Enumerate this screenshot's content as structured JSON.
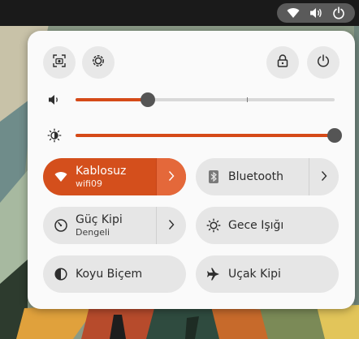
{
  "topbar": {
    "indicators": [
      {
        "icon": "wifi-icon"
      },
      {
        "icon": "volume-icon"
      },
      {
        "icon": "power-icon"
      }
    ]
  },
  "quick_settings": {
    "header_buttons": [
      {
        "icon": "screenshot-icon",
        "label": "Screenshot"
      },
      {
        "icon": "settings-icon",
        "label": "Settings"
      },
      {
        "icon": "lock-icon",
        "label": "Lock"
      },
      {
        "icon": "power-off-icon",
        "label": "Power Off"
      }
    ],
    "sliders": {
      "volume": {
        "icon": "speaker-icon",
        "value": 0.28,
        "marker": 0.66
      },
      "brightness": {
        "icon": "brightness-icon",
        "value": 1.0
      }
    },
    "tiles": {
      "wifi": {
        "title": "Kablosuz",
        "subtitle": "wifi09",
        "active": true,
        "icon": "wifi-icon"
      },
      "bluetooth": {
        "title": "Bluetooth",
        "subtitle": "",
        "active": false,
        "icon": "bluetooth-icon"
      },
      "power_mode": {
        "title": "Güç Kipi",
        "subtitle": "Dengeli",
        "active": false,
        "icon": "power-mode-icon"
      },
      "night_light": {
        "title": "Gece Işığı",
        "subtitle": "",
        "active": false,
        "icon": "night-light-icon"
      },
      "dark_style": {
        "title": "Koyu Biçem",
        "subtitle": "",
        "active": false,
        "icon": "dark-style-icon"
      },
      "airplane": {
        "title": "Uçak Kipi",
        "subtitle": "",
        "active": false,
        "icon": "airplane-icon"
      }
    }
  },
  "colors": {
    "accent": "#d44f1c",
    "panel_bg": "#fafafa",
    "tile_bg": "#e6e6e6",
    "topbar_bg": "#1a1a1a"
  }
}
